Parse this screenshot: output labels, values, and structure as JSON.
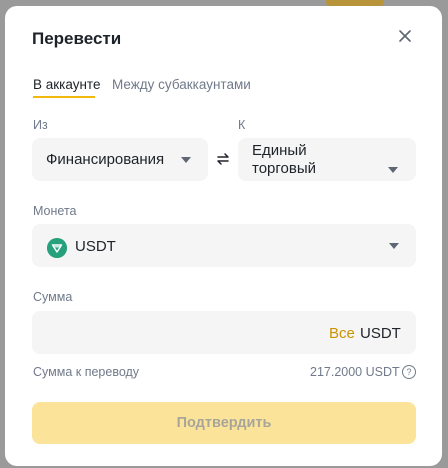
{
  "dialog": {
    "title": "Перевести",
    "tabs": [
      {
        "label": "В аккаунте",
        "active": true
      },
      {
        "label": "Между субаккаунтами",
        "active": false
      }
    ]
  },
  "from": {
    "label": "Из",
    "value": "Финансирования"
  },
  "to": {
    "label": "К",
    "value_line1": "Единый",
    "value_line2": "торговый"
  },
  "coin": {
    "label": "Монета",
    "value": "USDT",
    "icon": "tether-icon",
    "icon_color": "#26a17b"
  },
  "amount": {
    "label": "Сумма",
    "value": "",
    "all_label": "Все",
    "unit": "USDT"
  },
  "summary": {
    "label": "Сумма к переводу",
    "value": "217.2000 USDT"
  },
  "confirm_button": {
    "label": "Подтвердить",
    "disabled": true
  },
  "colors": {
    "accent": "#f0b90b",
    "all_link": "#c99400",
    "confirm_bg": "#fbe49a"
  }
}
